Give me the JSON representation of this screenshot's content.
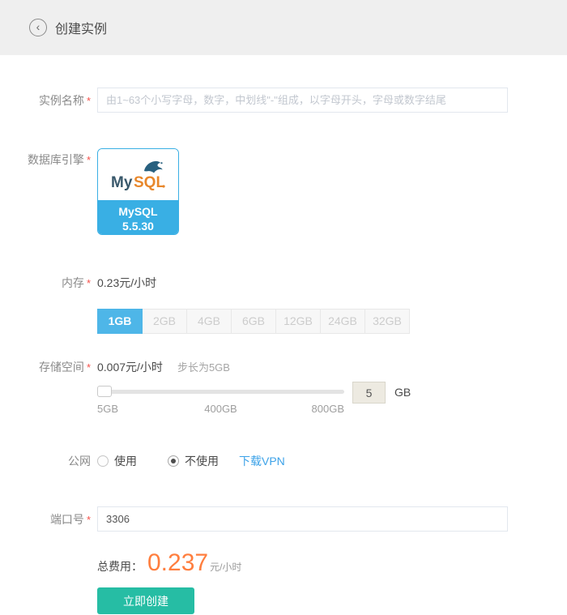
{
  "header": {
    "title": "创建实例"
  },
  "form": {
    "instance_name": {
      "label": "实例名称",
      "required": "*",
      "placeholder": "由1~63个小写字母，数字，中划线\"-\"组成，以字母开头，字母或数字结尾",
      "value": ""
    },
    "db_engine": {
      "label": "数据库引擎",
      "required": "*",
      "selected_card": {
        "logo_my": "My",
        "logo_sql": "SQL",
        "name": "MySQL",
        "version": "5.5.30"
      }
    },
    "memory": {
      "label": "内存",
      "required": "*",
      "price": "0.23元/小时",
      "options": [
        {
          "label": "1GB",
          "selected": true
        },
        {
          "label": "2GB",
          "selected": false
        },
        {
          "label": "4GB",
          "selected": false
        },
        {
          "label": "6GB",
          "selected": false
        },
        {
          "label": "12GB",
          "selected": false
        },
        {
          "label": "24GB",
          "selected": false
        },
        {
          "label": "32GB",
          "selected": false
        }
      ]
    },
    "storage": {
      "label": "存储空间",
      "required": "*",
      "price": "0.007元/小时",
      "step_note": "步长为5GB",
      "slider_labels": [
        "5GB",
        "400GB",
        "800GB"
      ],
      "value": "5",
      "unit": "GB"
    },
    "public_network": {
      "label": "公网",
      "options": [
        {
          "label": "使用",
          "checked": false
        },
        {
          "label": "不使用",
          "checked": true
        }
      ],
      "vpn_link": "下载VPN"
    },
    "port": {
      "label": "端口号",
      "required": "*",
      "value": "3306"
    }
  },
  "summary": {
    "total_label": "总费用：",
    "total_value": "0.237",
    "total_unit": "元/小时"
  },
  "actions": {
    "create_button": "立即创建"
  },
  "colors": {
    "accent_blue": "#39afe4",
    "selected_option_blue": "#4eb6e8",
    "button_teal": "#26bda4",
    "price_orange": "#ff7e3e",
    "link_blue": "#3ca2e8",
    "required_red": "#f5504a",
    "header_gray": "#efefef"
  }
}
